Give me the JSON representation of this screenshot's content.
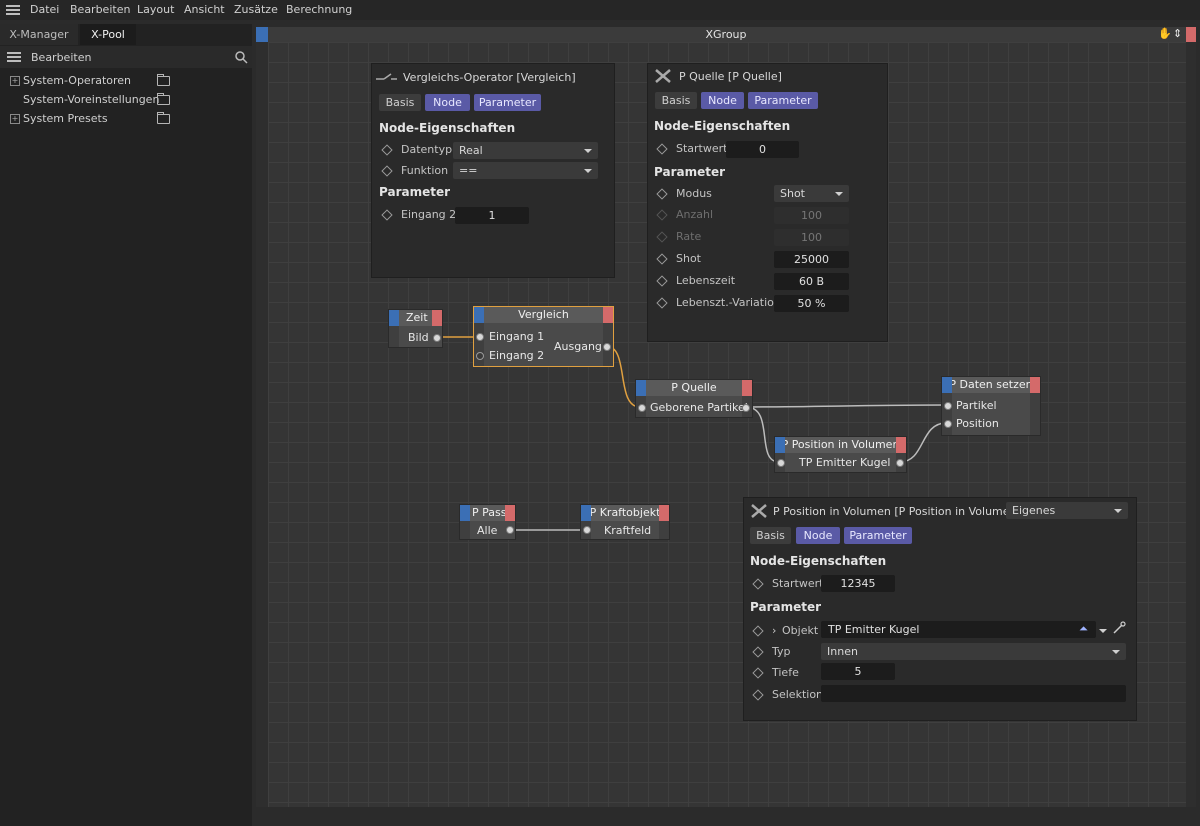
{
  "menubar": {
    "items": [
      "Datei",
      "Bearbeiten",
      "Layout",
      "Ansicht",
      "Zusätze",
      "Berechnung"
    ]
  },
  "left_panel": {
    "tabs": [
      "X-Manager",
      "X-Pool"
    ],
    "toolbar_label": "Bearbeiten",
    "tree": [
      "System-Operatoren",
      "System-Voreinstellungen",
      "System Presets"
    ]
  },
  "xgroup": {
    "title": "XGroup"
  },
  "vergleich_panel": {
    "title": "Vergleichs-Operator [Vergleich]",
    "tabs": [
      "Basis",
      "Node",
      "Parameter"
    ],
    "section1": "Node-Eigenschaften",
    "datentyp_label": "Datentyp",
    "datentyp_value": "Real",
    "funktion_label": "Funktion",
    "funktion_value": "==",
    "section2": "Parameter",
    "eingang2_label": "Eingang 2",
    "eingang2_value": "1"
  },
  "pquelle_panel": {
    "title": "P Quelle [P Quelle]",
    "tabs": [
      "Basis",
      "Node",
      "Parameter"
    ],
    "section1": "Node-Eigenschaften",
    "startwert_label": "Startwert",
    "startwert_value": "0",
    "section2": "Parameter",
    "rows": [
      {
        "label": "Modus",
        "value": "Shot"
      },
      {
        "label": "Anzahl",
        "value": "100"
      },
      {
        "label": "Rate",
        "value": "100"
      },
      {
        "label": "Shot",
        "value": "25000"
      },
      {
        "label": "Lebenszeit",
        "value": "60 B"
      },
      {
        "label": "Lebenszt.-Variation",
        "value": "50 %"
      }
    ]
  },
  "ppos_panel": {
    "title": "P Position in Volumen [P Position in Volumen]",
    "mode_value": "Eigenes",
    "tabs": [
      "Basis",
      "Node",
      "Parameter"
    ],
    "section1": "Node-Eigenschaften",
    "startwert_label": "Startwert",
    "startwert_value": "12345",
    "section2": "Parameter",
    "objekt_label": "Objekt",
    "objekt_value": "TP Emitter Kugel",
    "typ_label": "Typ",
    "typ_value": "Innen",
    "tiefe_label": "Tiefe",
    "tiefe_value": "5",
    "selektion_label": "Selektion",
    "selektion_value": ""
  },
  "nodes": {
    "zeit": {
      "title": "Zeit",
      "port": "Bild"
    },
    "vergleich": {
      "title": "Vergleich",
      "in1": "Eingang 1",
      "in2": "Eingang 2",
      "out": "Ausgang"
    },
    "pquelle": {
      "title": "P Quelle",
      "port": "Geborene Partikel"
    },
    "pdaten": {
      "title": "P Daten setzen",
      "in1": "Partikel",
      "in2": "Position"
    },
    "ppos": {
      "title": "P Position in Volumen",
      "port": "TP Emitter Kugel"
    },
    "ppass": {
      "title": "P Pass",
      "port": "Alle"
    },
    "pkraft": {
      "title": "P Kraftobjekt",
      "port": "Kraftfeld"
    }
  },
  "colors": {
    "accent_blue": "#5a5aa6",
    "node_blue": "#3b6fb5",
    "node_red": "#d46a6a",
    "wire_orange": "#e0a040"
  }
}
